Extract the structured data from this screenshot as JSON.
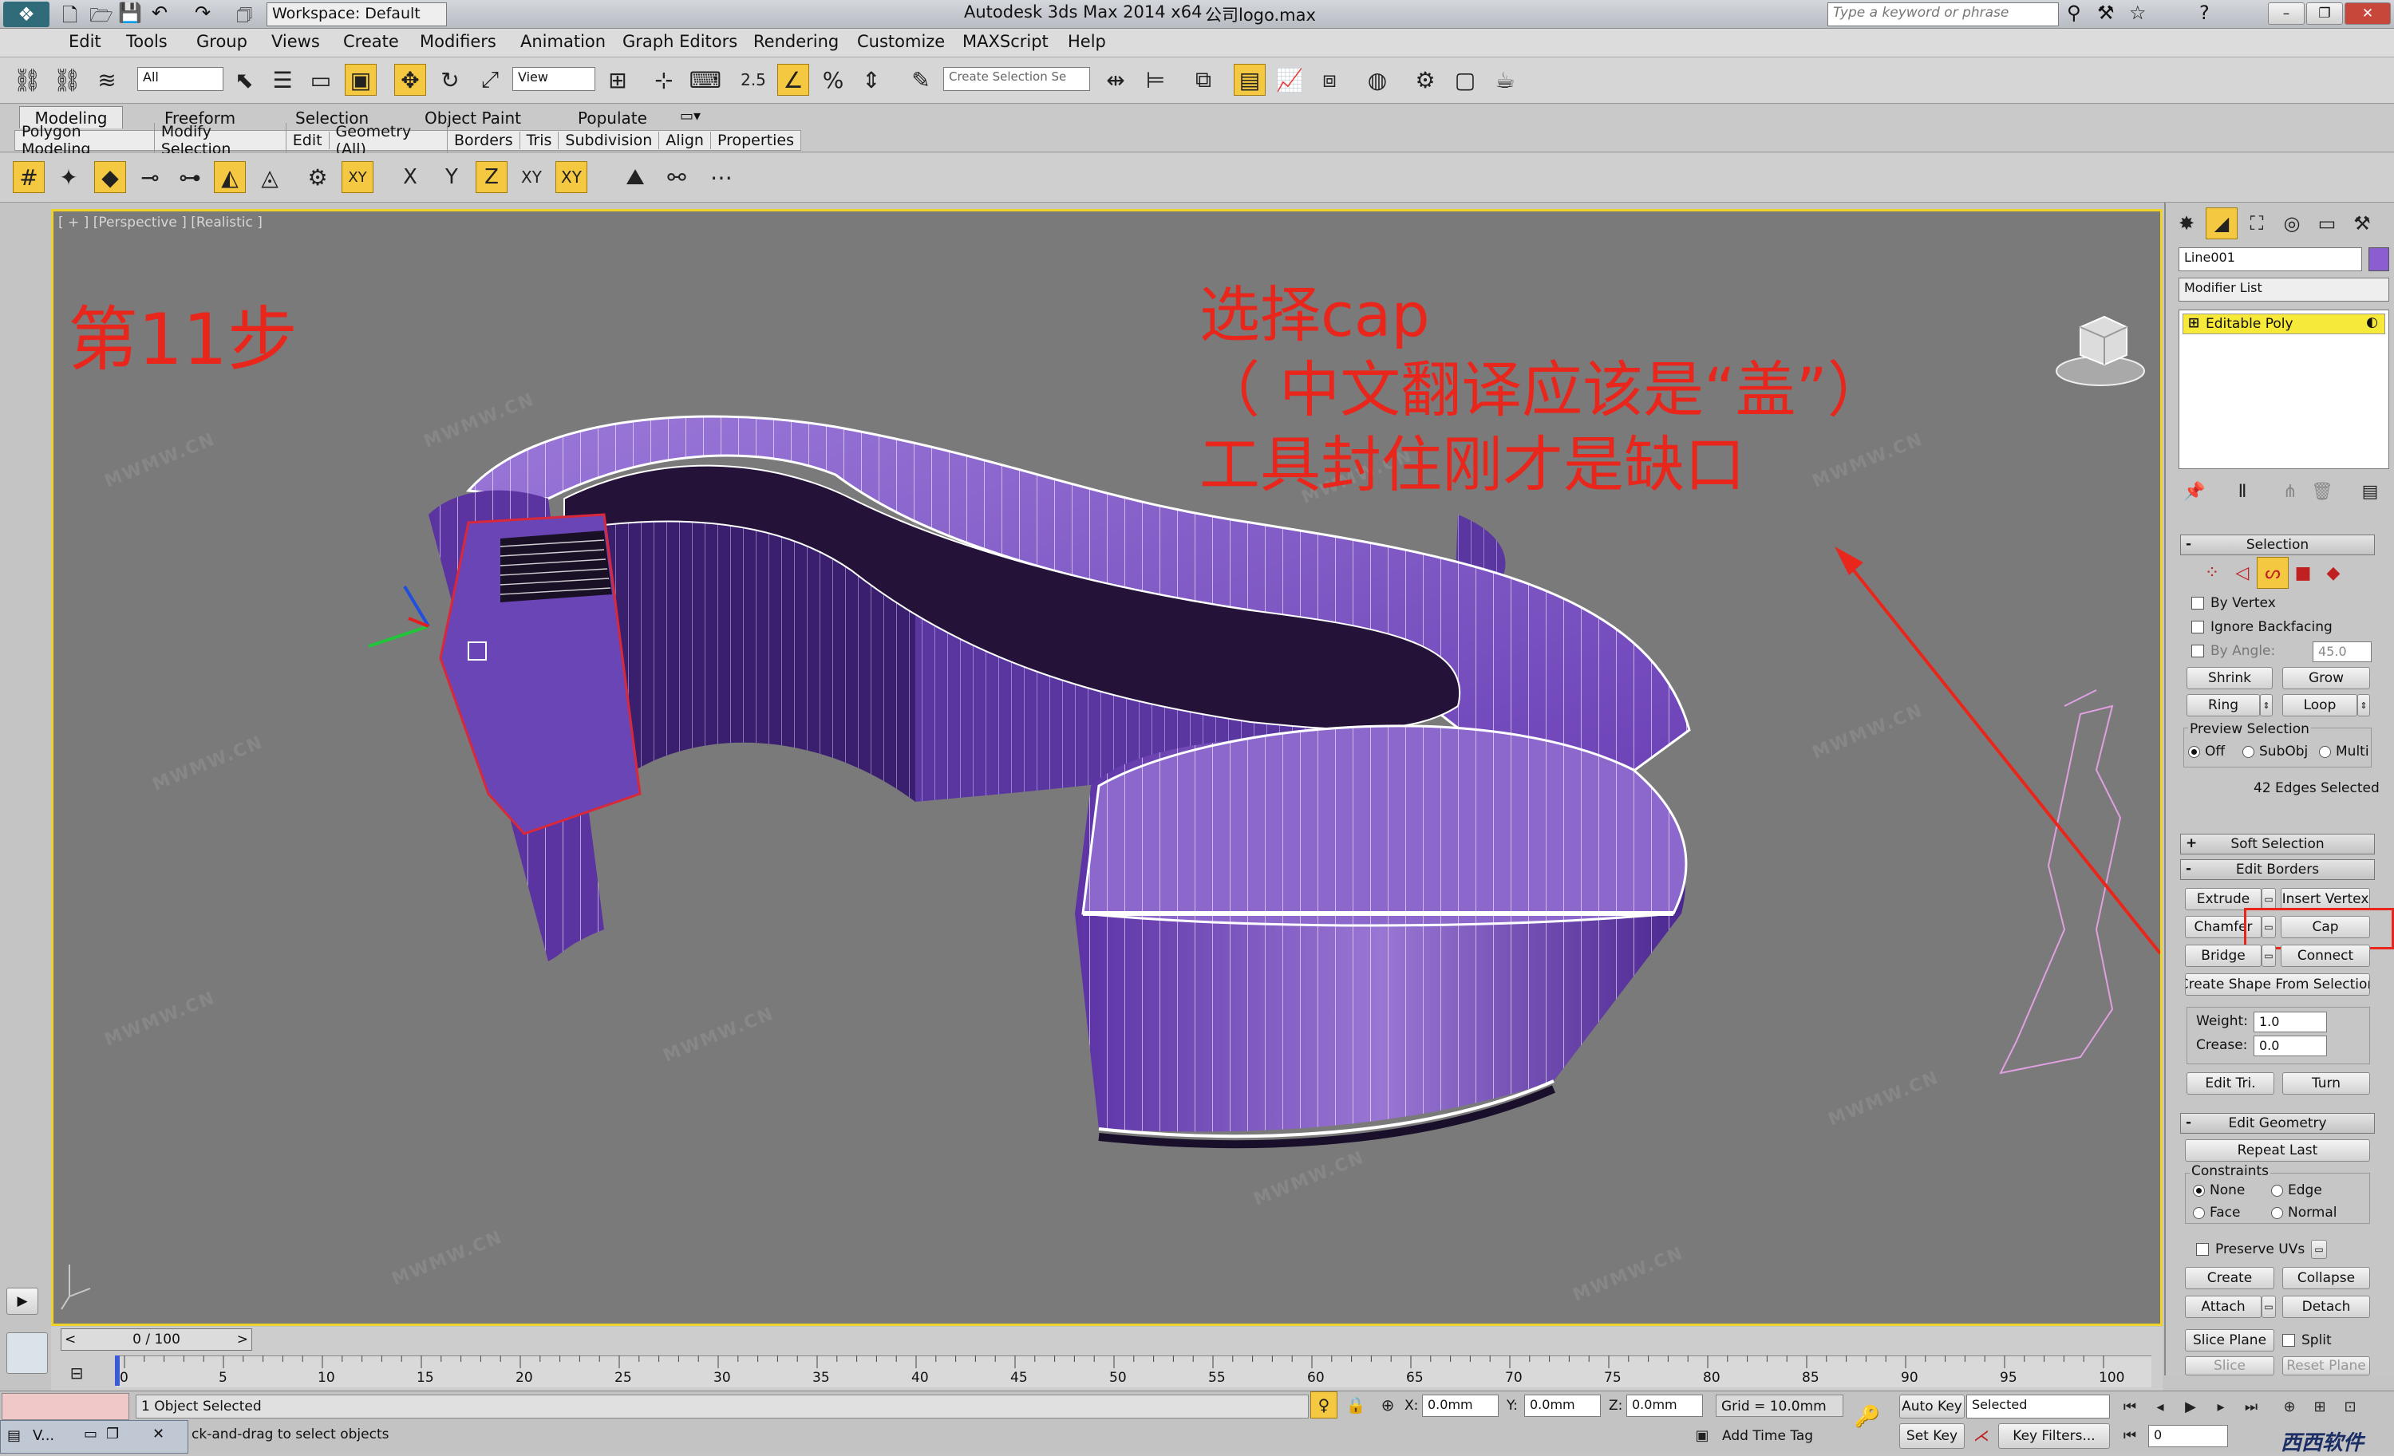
{
  "title_bar": {
    "workspace": "Workspace: Default",
    "app_title": "Autodesk 3ds Max  2014 x64",
    "file_name": "公司logo.max",
    "search_placeholder": "Type a keyword or phrase"
  },
  "menu": [
    "Edit",
    "Tools",
    "Group",
    "Views",
    "Create",
    "Modifiers",
    "Animation",
    "Graph Editors",
    "Rendering",
    "Customize",
    "MAXScript",
    "Help"
  ],
  "main_toolbar": {
    "selection_filter": "All",
    "ref_coord": "View",
    "snap_value": "2.5",
    "named_selection_placeholder": "Create Selection Se"
  },
  "ribbon": {
    "tabs": [
      "Modeling",
      "Freeform",
      "Selection",
      "Object Paint",
      "Populate"
    ],
    "panels": [
      "Polygon Modeling",
      "Modify Selection",
      "Edit",
      "Geometry (All)",
      "Borders",
      "Tris",
      "Subdivision",
      "Align",
      "Properties"
    ],
    "axis_buttons": [
      "X",
      "Y",
      "Z",
      "XY",
      "XY"
    ]
  },
  "viewport": {
    "label": "[ + ] [Perspective ] [Realistic ]",
    "watermark": "MWMW.CN",
    "step_text": "第11步",
    "note_line1": "选择cap",
    "note_line2": "（ 中文翻译应该是“盖”）",
    "note_line3": "工具封住刚才是缺口"
  },
  "command_panel": {
    "object_name": "Line001",
    "modifier_list": "Modifier List",
    "stack_item": "Editable Poly",
    "selection": {
      "title": "Selection",
      "by_vertex": "By Vertex",
      "ignore_backfacing": "Ignore Backfacing",
      "by_angle": "By Angle:",
      "angle_value": "45.0",
      "shrink": "Shrink",
      "grow": "Grow",
      "ring": "Ring",
      "loop": "Loop",
      "preview_title": "Preview Selection",
      "preview_off": "Off",
      "preview_subobj": "SubObj",
      "preview_multi": "Multi",
      "status": "42 Edges Selected"
    },
    "soft_selection": "Soft Selection",
    "edit_borders": {
      "title": "Edit Borders",
      "extrude": "Extrude",
      "insert_vertex": "Insert Vertex",
      "chamfer": "Chamfer",
      "cap": "Cap",
      "bridge": "Bridge",
      "connect": "Connect",
      "create_shape": "Create Shape From Selection",
      "weight_label": "Weight:",
      "weight_value": "1.0",
      "crease_label": "Crease:",
      "crease_value": "0.0",
      "edit_tri": "Edit Tri.",
      "turn": "Turn"
    },
    "edit_geometry": {
      "title": "Edit Geometry",
      "repeat_last": "Repeat Last",
      "constraints": "Constraints",
      "none": "None",
      "edge": "Edge",
      "face": "Face",
      "normal": "Normal",
      "preserve_uvs": "Preserve UVs",
      "create": "Create",
      "collapse": "Collapse",
      "attach": "Attach",
      "detach": "Detach",
      "slice_plane": "Slice Plane",
      "split": "Split",
      "slice": "Slice",
      "reset_plane": "Reset Plane"
    }
  },
  "timeline": {
    "frame": "0 / 100",
    "ticks": [
      "0",
      "5",
      "10",
      "15",
      "20",
      "25",
      "30",
      "35",
      "40",
      "45",
      "50",
      "55",
      "60",
      "65",
      "70",
      "75",
      "80",
      "85",
      "90",
      "95",
      "100"
    ]
  },
  "status_bar": {
    "selected": "1 Object Selected",
    "prompt": "ck-and-drag to select objects",
    "x_label": "X:",
    "x_value": "0.0mm",
    "y_label": "Y:",
    "y_value": "0.0mm",
    "z_label": "Z:",
    "z_value": "0.0mm",
    "grid": "Grid = 10.0mm",
    "auto_key": "Auto Key",
    "set_key": "Set Key",
    "key_mode": "Selected",
    "key_filters": "Key Filters...",
    "add_time_tag": "Add Time Tag",
    "frame_field": "0",
    "taskbar_item": "V...",
    "brand": "西西软件"
  },
  "colors": {
    "annotation": "#e8261c",
    "object": "#7b4fc2",
    "selection_highlight": "#f5c842"
  }
}
